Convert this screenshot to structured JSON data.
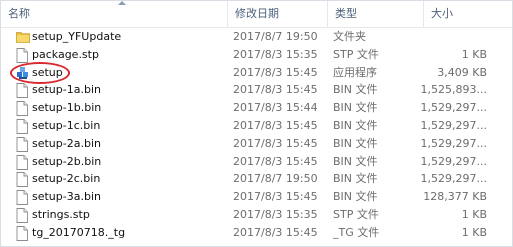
{
  "columns": {
    "name": "名称",
    "date": "修改日期",
    "type": "类型",
    "size": "大小"
  },
  "files": [
    {
      "name": "setup_YFUpdate",
      "date": "2017/8/7 19:50",
      "type": "文件夹",
      "size": "",
      "icon": "folder-icon"
    },
    {
      "name": "package.stp",
      "date": "2017/8/3 15:35",
      "type": "STP 文件",
      "size": "1 KB",
      "icon": "file-icon"
    },
    {
      "name": "setup",
      "date": "2017/8/3 15:45",
      "type": "应用程序",
      "size": "3,409 KB",
      "icon": "app-icon"
    },
    {
      "name": "setup-1a.bin",
      "date": "2017/8/3 15:45",
      "type": "BIN 文件",
      "size": "1,525,893...",
      "icon": "file-icon"
    },
    {
      "name": "setup-1b.bin",
      "date": "2017/8/3 15:44",
      "type": "BIN 文件",
      "size": "1,529,297...",
      "icon": "file-icon"
    },
    {
      "name": "setup-1c.bin",
      "date": "2017/8/3 15:45",
      "type": "BIN 文件",
      "size": "1,529,297...",
      "icon": "file-icon"
    },
    {
      "name": "setup-2a.bin",
      "date": "2017/8/3 15:45",
      "type": "BIN 文件",
      "size": "1,529,297...",
      "icon": "file-icon"
    },
    {
      "name": "setup-2b.bin",
      "date": "2017/8/3 15:45",
      "type": "BIN 文件",
      "size": "1,529,297...",
      "icon": "file-icon"
    },
    {
      "name": "setup-2c.bin",
      "date": "2017/8/7 19:50",
      "type": "BIN 文件",
      "size": "1,529,297...",
      "icon": "file-icon"
    },
    {
      "name": "setup-3a.bin",
      "date": "2017/8/3 15:45",
      "type": "BIN 文件",
      "size": "128,377 KB",
      "icon": "file-icon"
    },
    {
      "name": "strings.stp",
      "date": "2017/8/3 15:35",
      "type": "STP 文件",
      "size": "1 KB",
      "icon": "file-icon"
    },
    {
      "name": "tg_20170718._tg",
      "date": "2017/8/3 15:45",
      "type": "_TG 文件",
      "size": "1 KB",
      "icon": "file-icon"
    }
  ],
  "highlight": {
    "target": "setup",
    "color": "#d8292f"
  }
}
